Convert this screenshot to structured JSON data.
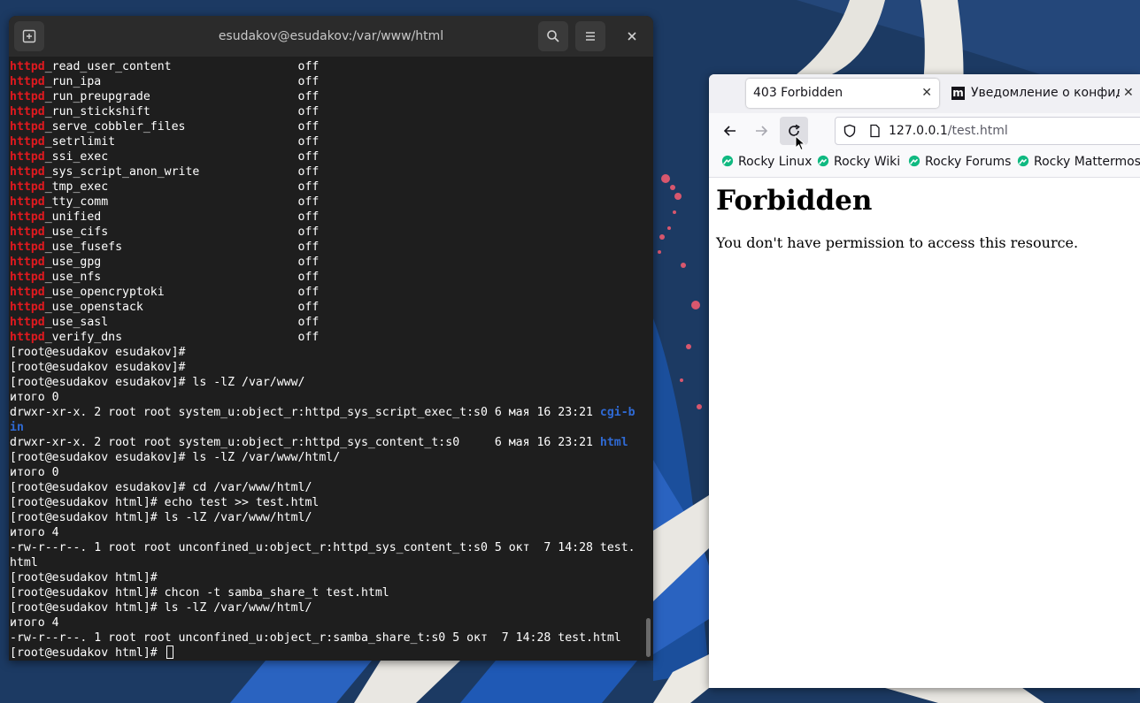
{
  "terminal": {
    "title": "esudakov@esudakov:/var/www/html",
    "lines": [
      {
        "seg": [
          {
            "t": "httpd",
            "c": "red"
          },
          {
            "t": "_read_user_content                  off"
          }
        ]
      },
      {
        "seg": [
          {
            "t": "httpd",
            "c": "red"
          },
          {
            "t": "_run_ipa                            off"
          }
        ]
      },
      {
        "seg": [
          {
            "t": "httpd",
            "c": "red"
          },
          {
            "t": "_run_preupgrade                     off"
          }
        ]
      },
      {
        "seg": [
          {
            "t": "httpd",
            "c": "red"
          },
          {
            "t": "_run_stickshift                     off"
          }
        ]
      },
      {
        "seg": [
          {
            "t": "httpd",
            "c": "red"
          },
          {
            "t": "_serve_cobbler_files                off"
          }
        ]
      },
      {
        "seg": [
          {
            "t": "httpd",
            "c": "red"
          },
          {
            "t": "_setrlimit                          off"
          }
        ]
      },
      {
        "seg": [
          {
            "t": "httpd",
            "c": "red"
          },
          {
            "t": "_ssi_exec                           off"
          }
        ]
      },
      {
        "seg": [
          {
            "t": "httpd",
            "c": "red"
          },
          {
            "t": "_sys_script_anon_write              off"
          }
        ]
      },
      {
        "seg": [
          {
            "t": "httpd",
            "c": "red"
          },
          {
            "t": "_tmp_exec                           off"
          }
        ]
      },
      {
        "seg": [
          {
            "t": "httpd",
            "c": "red"
          },
          {
            "t": "_tty_comm                           off"
          }
        ]
      },
      {
        "seg": [
          {
            "t": "httpd",
            "c": "red"
          },
          {
            "t": "_unified                            off"
          }
        ]
      },
      {
        "seg": [
          {
            "t": "httpd",
            "c": "red"
          },
          {
            "t": "_use_cifs                           off"
          }
        ]
      },
      {
        "seg": [
          {
            "t": "httpd",
            "c": "red"
          },
          {
            "t": "_use_fusefs                         off"
          }
        ]
      },
      {
        "seg": [
          {
            "t": "httpd",
            "c": "red"
          },
          {
            "t": "_use_gpg                            off"
          }
        ]
      },
      {
        "seg": [
          {
            "t": "httpd",
            "c": "red"
          },
          {
            "t": "_use_nfs                            off"
          }
        ]
      },
      {
        "seg": [
          {
            "t": "httpd",
            "c": "red"
          },
          {
            "t": "_use_opencryptoki                   off"
          }
        ]
      },
      {
        "seg": [
          {
            "t": "httpd",
            "c": "red"
          },
          {
            "t": "_use_openstack                      off"
          }
        ]
      },
      {
        "seg": [
          {
            "t": "httpd",
            "c": "red"
          },
          {
            "t": "_use_sasl                           off"
          }
        ]
      },
      {
        "seg": [
          {
            "t": "httpd",
            "c": "red"
          },
          {
            "t": "_verify_dns                         off"
          }
        ]
      },
      {
        "seg": [
          {
            "t": "[root@esudakov esudakov]#"
          }
        ]
      },
      {
        "seg": [
          {
            "t": "[root@esudakov esudakov]#"
          }
        ]
      },
      {
        "seg": [
          {
            "t": "[root@esudakov esudakov]# ls -lZ /var/www/"
          }
        ]
      },
      {
        "seg": [
          {
            "t": "итого 0"
          }
        ]
      },
      {
        "seg": [
          {
            "t": "drwxr-xr-x. 2 root root system_u:object_r:httpd_sys_script_exec_t:s0 6 мая 16 23:21 "
          },
          {
            "t": "cgi-b",
            "c": "blue"
          }
        ]
      },
      {
        "seg": [
          {
            "t": "in",
            "c": "blue"
          }
        ]
      },
      {
        "seg": [
          {
            "t": "drwxr-xr-x. 2 root root system_u:object_r:httpd_sys_content_t:s0     6 мая 16 23:21 "
          },
          {
            "t": "html",
            "c": "blue"
          }
        ]
      },
      {
        "seg": [
          {
            "t": "[root@esudakov esudakov]# ls -lZ /var/www/html/"
          }
        ]
      },
      {
        "seg": [
          {
            "t": "итого 0"
          }
        ]
      },
      {
        "seg": [
          {
            "t": "[root@esudakov esudakov]# cd /var/www/html/"
          }
        ]
      },
      {
        "seg": [
          {
            "t": "[root@esudakov html]# echo test >> test.html"
          }
        ]
      },
      {
        "seg": [
          {
            "t": "[root@esudakov html]# ls -lZ /var/www/html/"
          }
        ]
      },
      {
        "seg": [
          {
            "t": "итого 4"
          }
        ]
      },
      {
        "seg": [
          {
            "t": "-rw-r--r--. 1 root root unconfined_u:object_r:httpd_sys_content_t:s0 5 окт  7 14:28 test."
          }
        ]
      },
      {
        "seg": [
          {
            "t": "html"
          }
        ]
      },
      {
        "seg": [
          {
            "t": "[root@esudakov html]#"
          }
        ]
      },
      {
        "seg": [
          {
            "t": "[root@esudakov html]# chcon -t samba_share_t test.html"
          }
        ]
      },
      {
        "seg": [
          {
            "t": "[root@esudakov html]# ls -lZ /var/www/html/"
          }
        ]
      },
      {
        "seg": [
          {
            "t": "итого 4"
          }
        ]
      },
      {
        "seg": [
          {
            "t": "-rw-r--r--. 1 root root unconfined_u:object_r:samba_share_t:s0 5 окт  7 14:28 test.html"
          }
        ]
      },
      {
        "seg": [
          {
            "t": "[root@esudakov html]# "
          }
        ],
        "cursor": true
      }
    ],
    "icons": {
      "new_tab": "new-tab-icon",
      "search": "search-icon",
      "menu": "hamburger-menu-icon",
      "close": "close-icon"
    }
  },
  "browser": {
    "tabs": [
      {
        "title": "403 Forbidden",
        "active": true
      },
      {
        "title": "Уведомление о конфиденциальности",
        "favicon": "m"
      }
    ],
    "url": {
      "host": "127.0.0.1",
      "path": "/test.html"
    },
    "bookmarks": [
      "Rocky Linux",
      "Rocky Wiki",
      "Rocky Forums",
      "Rocky Mattermost"
    ],
    "page": {
      "heading": "Forbidden",
      "message": "You don't have permission to access this resource."
    }
  },
  "colors": {
    "terminal_bg": "#1e1e1e",
    "terminal_red": "#e0191f",
    "terminal_blue": "#2f6ad4",
    "rocky_green": "#10b981",
    "desktop_blue": "#1c3a63"
  }
}
